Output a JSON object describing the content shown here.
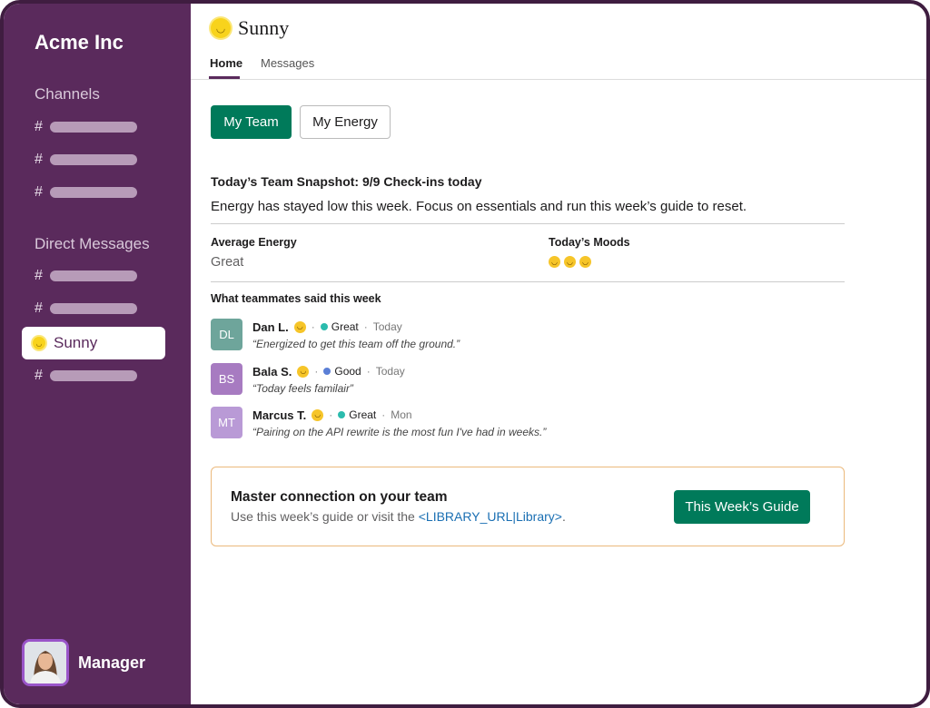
{
  "sidebar": {
    "workspace_name": "Acme Inc",
    "channels_heading": "Channels",
    "dm_heading": "Direct Messages",
    "channel_prefix": "#",
    "active_item": "Sunny",
    "user_role": "Manager"
  },
  "header": {
    "app_name": "Sunny",
    "tabs": [
      {
        "label": "Home",
        "active": true
      },
      {
        "label": "Messages",
        "active": false
      }
    ]
  },
  "toggle": {
    "my_team": "My Team",
    "my_energy": "My Energy"
  },
  "snapshot": {
    "title": "Today’s Team Snapshot: 9/9 Check-ins today",
    "description": "Energy has stayed low this week. Focus on essentials and run this week’s guide to reset.",
    "avg_energy_label": "Average Energy",
    "avg_energy_value": "Great",
    "moods_label": "Today’s Moods"
  },
  "feedback": {
    "heading": "What teammates said this week",
    "entries": [
      {
        "initials": "DL",
        "name": "Dan L.",
        "status": "Great",
        "status_color": "#2bbbad",
        "when": "Today",
        "quote": "“Energized to get this team off the ground.”",
        "avatar_color": "#6ea59b"
      },
      {
        "initials": "BS",
        "name": "Bala S.",
        "status": "Good",
        "status_color": "#5b7fd6",
        "when": "Today",
        "quote": "“Today feels familair”",
        "avatar_color": "#a77bc1"
      },
      {
        "initials": "MT",
        "name": "Marcus T.",
        "status": "Great",
        "status_color": "#2bbbad",
        "when": "Mon",
        "quote": "“Pairing on the API rewrite is the most fun I've had in weeks.”",
        "avatar_color": "#b99ad6"
      }
    ]
  },
  "card": {
    "title": "Master connection on your team",
    "text_before": "Use this week’s guide or visit the ",
    "link_text": "<LIBRARY_URL|Library>",
    "text_after": ".",
    "button_label": "This Week’s Guide"
  },
  "colors": {
    "sidebar": "#5a2a5c",
    "accent_green": "#007a5a",
    "card_border": "#ebb97c",
    "link": "#1a6fb3"
  },
  "icons": {
    "sun": "sun-smiley-icon",
    "mood": "smiley-emoji-icon",
    "hash": "hash-icon"
  }
}
